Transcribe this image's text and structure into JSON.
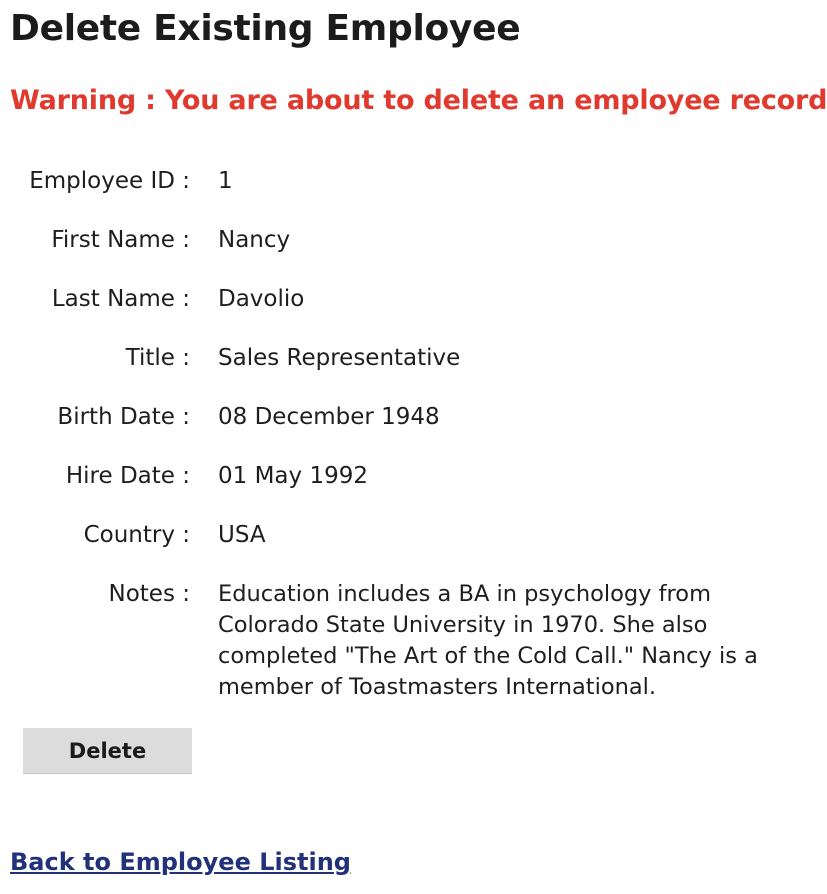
{
  "page": {
    "title": "Delete Existing Employee",
    "warning": "Warning : You are about to delete an employee record."
  },
  "employee": {
    "fields": [
      {
        "label": "Employee ID :",
        "value": "1"
      },
      {
        "label": "First Name :",
        "value": "Nancy"
      },
      {
        "label": "Last Name :",
        "value": "Davolio"
      },
      {
        "label": "Title :",
        "value": "Sales Representative"
      },
      {
        "label": "Birth Date :",
        "value": "08 December 1948"
      },
      {
        "label": "Hire Date :",
        "value": "01 May 1992"
      },
      {
        "label": "Country :",
        "value": "USA"
      },
      {
        "label": "Notes :",
        "value": "Education includes a BA in psychology from Colorado State University in 1970. She also completed \"The Art of the Cold Call.\" Nancy is a member of Toastmasters International."
      }
    ]
  },
  "actions": {
    "delete_label": "Delete",
    "back_link": "Back to Employee Listing"
  },
  "colors": {
    "warning": "#e03a2f",
    "link": "#22327a",
    "button_bg": "#dcdcdc"
  }
}
